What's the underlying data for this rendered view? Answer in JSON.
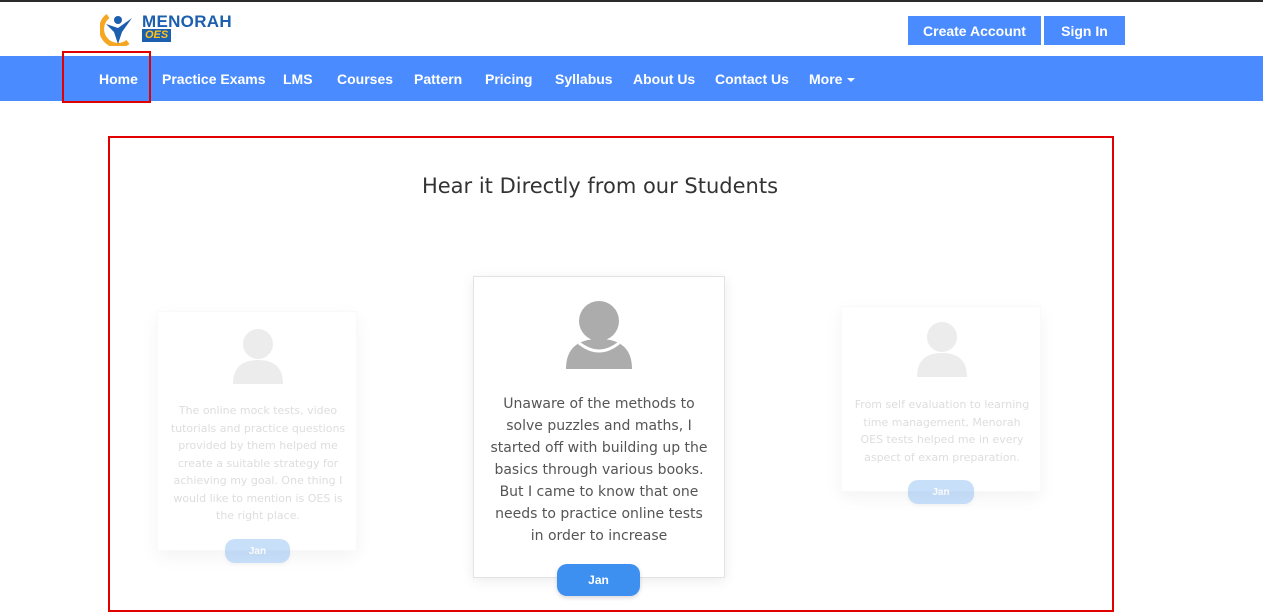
{
  "header": {
    "logo_text": "MENORAH",
    "logo_sub": "OES",
    "create_account_label": "Create Account",
    "sign_in_label": "Sign In"
  },
  "nav": {
    "items": [
      "Home",
      "Practice Exams",
      "LMS",
      "Courses",
      "Pattern",
      "Pricing",
      "Syllabus",
      "About Us",
      "Contact Us",
      "More"
    ]
  },
  "section": {
    "title": "Hear it Directly from our Students"
  },
  "testimonials": [
    {
      "text": "The online mock tests, video tutorials and practice questions provided by them helped me create a suitable strategy for achieving my goal. One thing I would like to mention is OES is the right place.",
      "button_label": "Jan"
    },
    {
      "text": "Unaware of the methods to solve puzzles and maths, I started off with building up the basics through various books. But I came to know that one needs to practice online tests in order to increase",
      "button_label": "Jan"
    },
    {
      "text": "From self evaluation to learning time management, Menorah OES tests helped me in every aspect of exam preparation.",
      "button_label": "Jan"
    }
  ],
  "colors": {
    "primary": "#4a8cff",
    "pill": "#3d8ff0",
    "highlight": "#e00000",
    "brand": "#1c5fae"
  }
}
